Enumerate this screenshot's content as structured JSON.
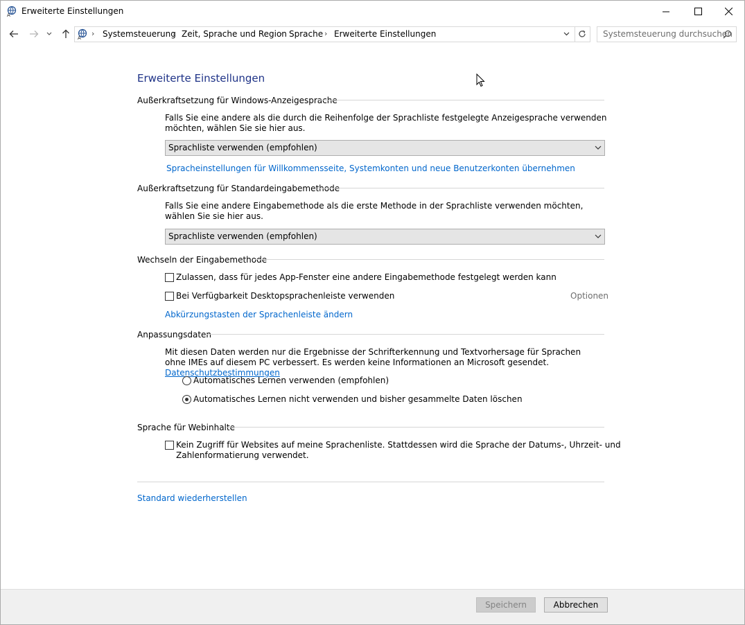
{
  "window": {
    "title": "Erweiterte Einstellungen"
  },
  "breadcrumb": {
    "items": [
      "Systemsteuerung",
      "Zeit, Sprache und Region",
      "Sprache",
      "Erweiterte Einstellungen"
    ]
  },
  "search": {
    "placeholder": "Systemsteuerung durchsuchen"
  },
  "main": {
    "title": "Erweiterte Einstellungen",
    "display_language": {
      "heading": "Außerkraftsetzung für Windows-Anzeigesprache",
      "description": "Falls Sie eine andere als die durch die Reihenfolge der Sprachliste festgelegte Anzeigesprache verwenden möchten, wählen Sie sie hier aus.",
      "select_value": "Sprachliste verwenden (empfohlen)",
      "link": "Spracheinstellungen für Willkommensseite, Systemkonten und neue Benutzerkonten übernehmen"
    },
    "input_method": {
      "heading": "Außerkraftsetzung für Standardeingabemethode",
      "description": "Falls Sie eine andere Eingabemethode als die erste Methode in der Sprachliste verwenden möchten, wählen Sie sie hier aus.",
      "select_value": "Sprachliste verwenden (empfohlen)"
    },
    "switching": {
      "heading": "Wechseln der Eingabemethode",
      "checkbox1": "Zulassen, dass für jedes App-Fenster eine andere Eingabemethode festgelegt werden kann",
      "checkbox2": "Bei Verfügbarkeit Desktopsprachenleiste verwenden",
      "options": "Optionen",
      "link": "Abkürzungstasten der Sprachenleiste ändern"
    },
    "personalization": {
      "heading": "Anpassungsdaten",
      "description": "Mit diesen Daten werden nur die Ergebnisse der Schrifterkennung und Textvorhersage für Sprachen ohne IMEs auf diesem PC verbessert. Es werden keine Informationen an Microsoft gesendet.",
      "privacy_link": "Datenschutzbestimmungen",
      "radio1": "Automatisches Lernen verwenden (empfohlen)",
      "radio2": "Automatisches Lernen nicht verwenden und bisher gesammelte Daten löschen",
      "selected": 2
    },
    "web": {
      "heading": "Sprache für Webinhalte",
      "checkbox_line1": "Kein Zugriff für Websites auf meine Sprachenliste. Stattdessen wird die Sprache der Datums-, Uhrzeit- und",
      "checkbox_line2": "Zahlenformatierung verwendet."
    },
    "restore_link": "Standard wiederherstellen"
  },
  "footer": {
    "save": "Speichern",
    "cancel": "Abbrechen"
  },
  "colors": {
    "link": "#0066cc",
    "title": "#1e3287"
  }
}
